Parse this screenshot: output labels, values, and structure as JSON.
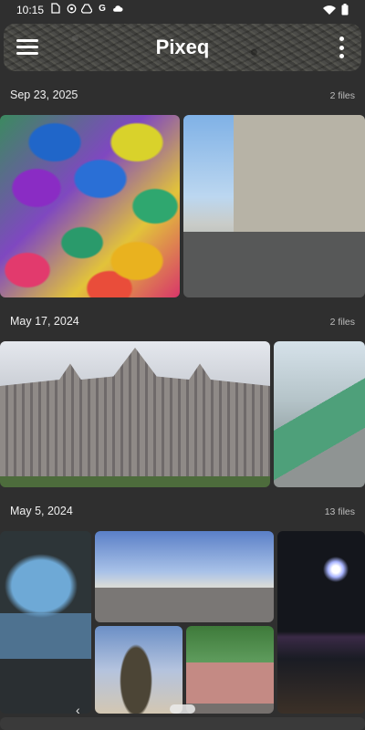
{
  "status_bar": {
    "time": "10:15",
    "left_icons": [
      "sim-card-icon",
      "photos-icon",
      "drive-icon",
      "google-icon",
      "cloud-icon"
    ],
    "right_icons": [
      "wifi-icon",
      "battery-icon"
    ]
  },
  "toolbar": {
    "title": "Pixeq",
    "menu_icon": "hamburger-menu-icon",
    "more_icon": "more-vert-icon"
  },
  "sections": [
    {
      "date": "Sep 23, 2025",
      "count": "2 files",
      "photos": [
        "umbrellas-photo",
        "building-road-photo"
      ]
    },
    {
      "date": "May 17, 2024",
      "count": "2 files",
      "photos": [
        "parliament-photo",
        "bridge-walkway-photo"
      ]
    },
    {
      "date": "May 5, 2024",
      "count": "13 files",
      "photos": [
        "cave-photo",
        "city-square-photo",
        "night-river-photo",
        "statue-photo",
        "fountain-photo"
      ]
    }
  ],
  "nav": {
    "back_icon": "chevron-left-icon",
    "handle": "scroll-handle"
  }
}
